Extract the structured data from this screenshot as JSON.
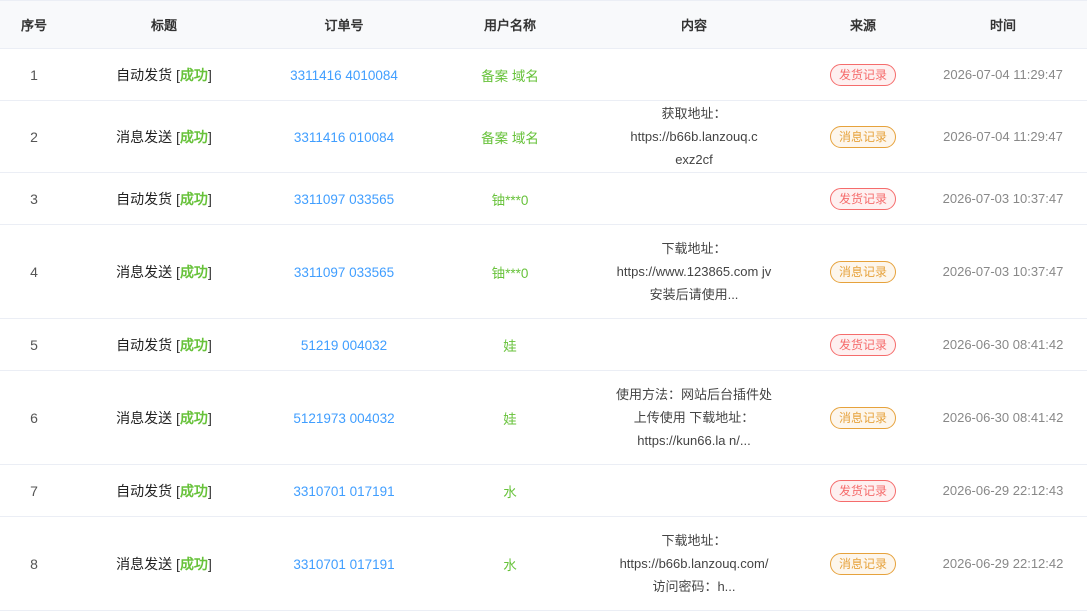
{
  "columns": {
    "index": "序号",
    "title": "标题",
    "order": "订单号",
    "user": "用户名称",
    "content": "内容",
    "source": "来源",
    "time": "时间"
  },
  "status_open": "[",
  "status_close": "]",
  "rows": [
    {
      "index": "1",
      "title": "自动发货",
      "status": "成功",
      "order": "3311416          4010084",
      "user": "备案      域名",
      "content": "",
      "source": "发货记录",
      "source_color": "#f56c6c",
      "time": "2026-07-04 11:29:47"
    },
    {
      "index": "2",
      "title": "消息发送",
      "status": "成功",
      "order": "3311416          010084",
      "user": "备案      域名",
      "content": "获取地址： https://b66b.lanzouq.c           exz2cf",
      "source": "消息记录",
      "source_color": "#e6a23c",
      "time": "2026-07-04 11:29:47"
    },
    {
      "index": "3",
      "title": "自动发货",
      "status": "成功",
      "order": "3311097          033565",
      "user": "铀***0",
      "content": "",
      "source": "发货记录",
      "source_color": "#f56c6c",
      "time": "2026-07-03 10:37:47"
    },
    {
      "index": "4",
      "title": "消息发送",
      "status": "成功",
      "order": "3311097          033565",
      "user": "铀***0",
      "content": "下载地址：https://www.123865.com           jv 安装后请使用...",
      "source": "消息记录",
      "source_color": "#e6a23c",
      "time": "2026-07-03 10:37:47"
    },
    {
      "index": "5",
      "title": "自动发货",
      "status": "成功",
      "order": "51219            004032",
      "user": "娃      ",
      "content": "",
      "source": "发货记录",
      "source_color": "#f56c6c",
      "time": "2026-06-30 08:41:42"
    },
    {
      "index": "6",
      "title": "消息发送",
      "status": "成功",
      "order": "5121973          004032",
      "user": "娃      ",
      "content": "使用方法：网站后台插件处上传使用 下载地址：https://kun66.la           n/...",
      "source": "消息记录",
      "source_color": "#e6a23c",
      "time": "2026-06-30 08:41:42"
    },
    {
      "index": "7",
      "title": "自动发货",
      "status": "成功",
      "order": "3310701          017191",
      "user": "水      ",
      "content": "",
      "source": "发货记录",
      "source_color": "#f56c6c",
      "time": "2026-06-29 22:12:43"
    },
    {
      "index": "8",
      "title": "消息发送",
      "status": "成功",
      "order": "3310701          017191",
      "user": "水      ",
      "content": "下载地址：https://b66b.lanzouq.com/           访问密码：h...",
      "source": "消息记录",
      "source_color": "#e6a23c",
      "time": "2026-06-29 22:12:42"
    }
  ]
}
